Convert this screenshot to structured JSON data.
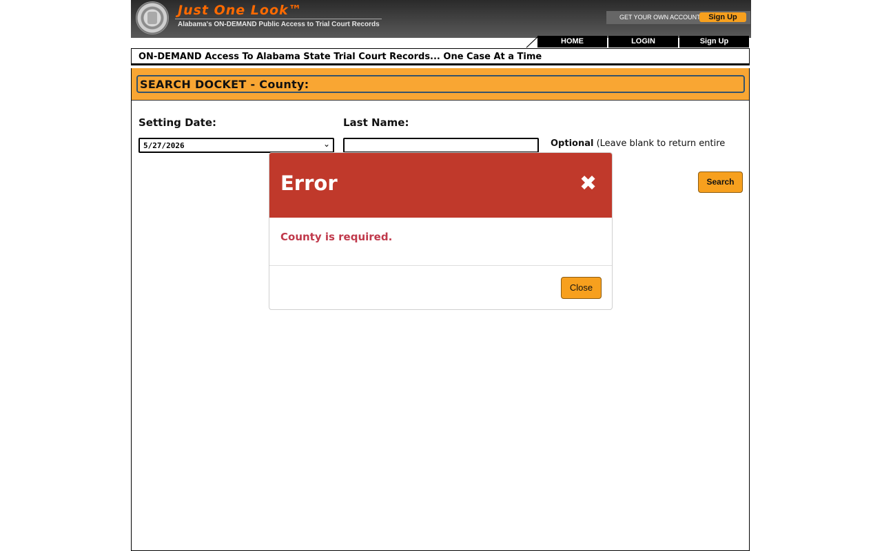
{
  "header": {
    "brand_title": "Just One Look™",
    "brand_subtitle": "Alabama's ON-DEMAND Public Access to Trial Court Records",
    "account_text": "GET YOUR OWN ACCOUNT",
    "signup_label": "Sign Up",
    "logo_icon": "court-seal-icon"
  },
  "nav": {
    "items": [
      {
        "label": "HOME"
      },
      {
        "label": "LOGIN"
      },
      {
        "label": "Sign Up"
      }
    ]
  },
  "tagline": "ON-DEMAND Access To Alabama State Trial Court Records... One Case At a Time",
  "search": {
    "title": "SEARCH DOCKET - County:",
    "setting_date_label": "Setting Date:",
    "setting_date_value": "5/27/2026",
    "last_name_label": "Last Name:",
    "last_name_value": "",
    "optional_bold": "Optional",
    "optional_text": "(Leave blank to return entire",
    "search_button": "Search"
  },
  "modal": {
    "title": "Error",
    "close_icon": "✖",
    "message": "County is required.",
    "close_button": "Close"
  },
  "colors": {
    "accent_orange": "#f7a01e",
    "error_red": "#c0392b",
    "header_dark": "#3a3a3a"
  }
}
